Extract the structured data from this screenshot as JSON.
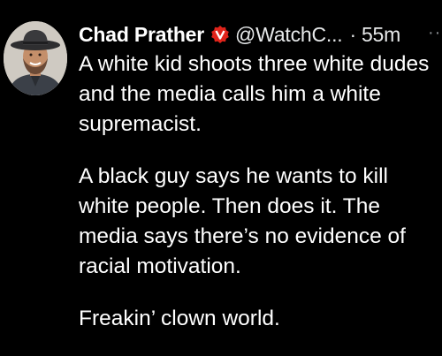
{
  "tweet": {
    "author_name": "Chad Prather",
    "verified_badge_icon": "red-verified-badge-icon",
    "handle": "@WatchC...",
    "separator": "·",
    "time": "55m",
    "more_icon": "more-options-icon",
    "paragraphs": [
      "A white kid shoots three white dudes and the media calls him a white supremacist.",
      "A black guy says he wants to kill white people. Then does it. The media says there’s no evidence of racial motivation.",
      "Freakin’ clown world."
    ]
  },
  "colors": {
    "background": "#000000",
    "text": "#ffffff",
    "badge": "#e0241b"
  }
}
